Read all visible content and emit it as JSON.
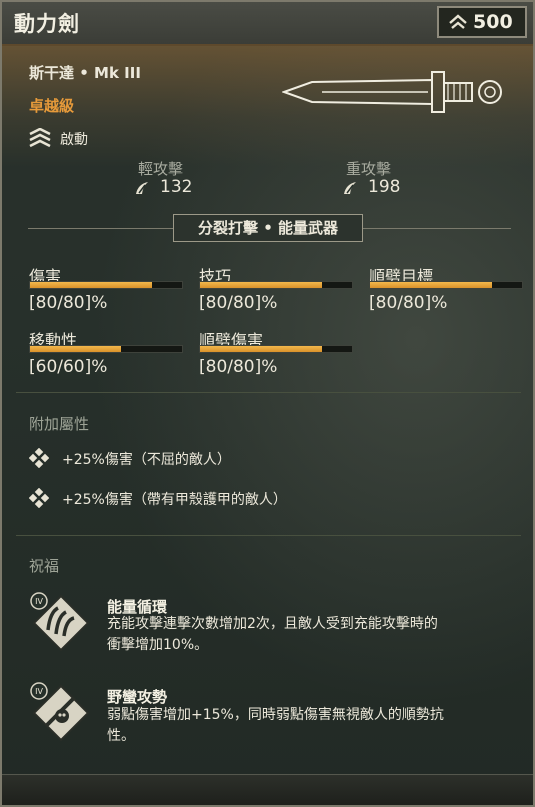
{
  "header": {
    "title": "動力劍",
    "power_value": "500",
    "power_icon": "chevron-up-icon"
  },
  "item": {
    "subtitle": "斯干達 • Mk III",
    "rarity": "卓越級",
    "rarity_color": "#e69a3a",
    "active_label": "啟動",
    "active_icon": "stacked-chevrons-icon"
  },
  "attacks": {
    "light": {
      "label": "輕攻擊",
      "value": "132"
    },
    "heavy": {
      "label": "重攻擊",
      "value": "198"
    }
  },
  "trait": "分裂打擊 • 能量武器",
  "stats": [
    {
      "label": "傷害",
      "value": "[80/80]%",
      "fill": 0.8
    },
    {
      "label": "技巧",
      "value": "[80/80]%",
      "fill": 0.8
    },
    {
      "label": "順劈目標",
      "value": "[80/80]%",
      "fill": 0.8
    },
    {
      "label": "移動性",
      "value": "[60/60]%",
      "fill": 0.6
    },
    {
      "label": "順劈傷害",
      "value": "[80/80]%",
      "fill": 0.8
    }
  ],
  "properties": {
    "title": "附加屬性",
    "items": [
      "+25%傷害（不屈的敵人）",
      "+25%傷害（帶有甲殼護甲的敵人）"
    ]
  },
  "blessings": {
    "title": "祝福",
    "items": [
      {
        "tier": "IV",
        "name": "能量循環",
        "desc": "充能攻擊連擊次數增加2次，且敵人受到充能攻擊時的衝擊增加10%。"
      },
      {
        "tier": "IV",
        "name": "野蠻攻勢",
        "desc": "弱點傷害增加+15%，同時弱點傷害無視敵人的順勢抗性。"
      }
    ]
  },
  "colors": {
    "accent_bar": "#e9a53a",
    "panel": "#27302b"
  }
}
